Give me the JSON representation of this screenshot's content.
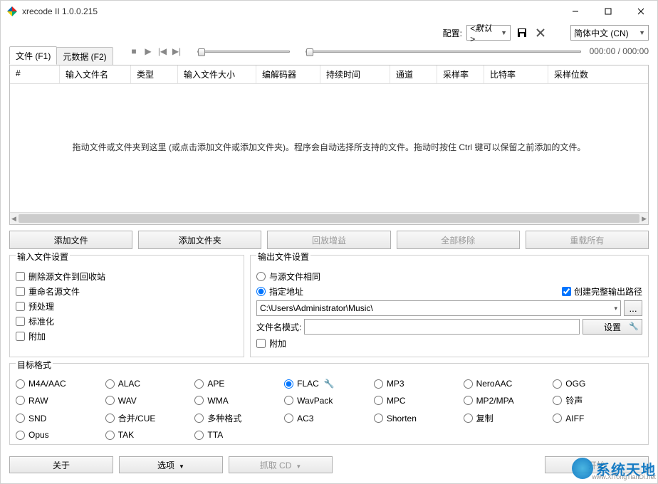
{
  "titlebar": {
    "title": "xrecode II 1.0.0.215"
  },
  "top": {
    "config_label": "配置:",
    "default_select": "<默认>",
    "lang": "简体中文 (CN)"
  },
  "player": {
    "time": "000:00 / 000:00"
  },
  "tabs": {
    "files": "文件 (F1)",
    "meta": "元数据 (F2)"
  },
  "table": {
    "headers": [
      "#",
      "输入文件名",
      "类型",
      "输入文件大小",
      "编解码器",
      "持续时间",
      "通道",
      "采样率",
      "比特率",
      "采样位数"
    ],
    "empty_msg": "拖动文件或文件夹到这里 (或点击添加文件或添加文件夹)。程序会自动选择所支持的文件。拖动时按住 Ctrl 键可以保留之前添加的文件。"
  },
  "buttons": {
    "add_file": "添加文件",
    "add_folder": "添加文件夹",
    "replay_gain": "回放增益",
    "remove_all": "全部移除",
    "reload_all": "重载所有"
  },
  "input_panel": {
    "title": "输入文件设置",
    "del_to_recycle": "删除源文件到回收站",
    "rename_src": "重命名源文件",
    "preprocess": "预处理",
    "normalize": "标准化",
    "append": "附加"
  },
  "output_panel": {
    "title": "输出文件设置",
    "same_as_src": "与源文件相同",
    "specify_path": "指定地址",
    "create_full_path": "创建完整输出路径",
    "path_value": "C:\\Users\\Administrator\\Music\\",
    "filename_pattern_label": "文件名模式:",
    "settings_btn": "设置",
    "append": "附加",
    "browse": "..."
  },
  "formats": {
    "title": "目标格式",
    "items": [
      "M4A/AAC",
      "ALAC",
      "APE",
      "FLAC",
      "MP3",
      "NeroAAC",
      "OGG",
      "RAW",
      "WAV",
      "WMA",
      "WavPack",
      "MPC",
      "MP2/MPA",
      "铃声",
      "SND",
      "合并/CUE",
      "多种格式",
      "AC3",
      "Shorten",
      "复制",
      "AIFF",
      "Opus",
      "TAK",
      "TTA"
    ],
    "selected": "FLAC"
  },
  "bottom": {
    "about": "关于",
    "options": "选项",
    "grab_cd": "抓取 CD",
    "start": "开始"
  },
  "watermark": {
    "text": "系统天地",
    "sub": "www.XiTongTianDi.net"
  }
}
